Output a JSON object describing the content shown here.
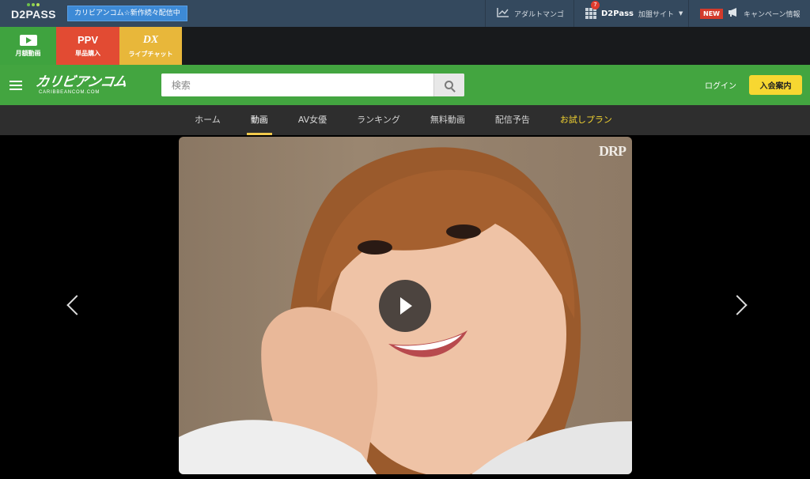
{
  "topbar": {
    "logo": "D2PASS",
    "promo": "カリビアンコム☆新作続々配信中",
    "manga_label": "アダルトマンゴ",
    "d2sites_badge": "7",
    "d2sites_brand": "D2Pass",
    "d2sites_label": "加盟サイト",
    "new_badge": "NEW",
    "campaign_label": "キャンペーン情報"
  },
  "services": {
    "monthly_label": "月額動画",
    "ppv_title": "PPV",
    "ppv_label": "単品購入",
    "live_title": "DX",
    "live_label": "ライブチャット"
  },
  "header": {
    "brand_jp": "カリビアンコム",
    "brand_en": "CARIBBEANCOM.COM",
    "search_placeholder": "検索",
    "login": "ログイン",
    "join": "入会案内",
    "colors": {
      "accent": "#43a540",
      "join_button": "#f7d731"
    }
  },
  "nav": {
    "tabs": [
      "ホーム",
      "動画",
      "AV女優",
      "ランキング",
      "無料動画",
      "配信予告",
      "お試しプラン"
    ],
    "active_index": 1
  },
  "hero": {
    "watermark": "DRP"
  }
}
